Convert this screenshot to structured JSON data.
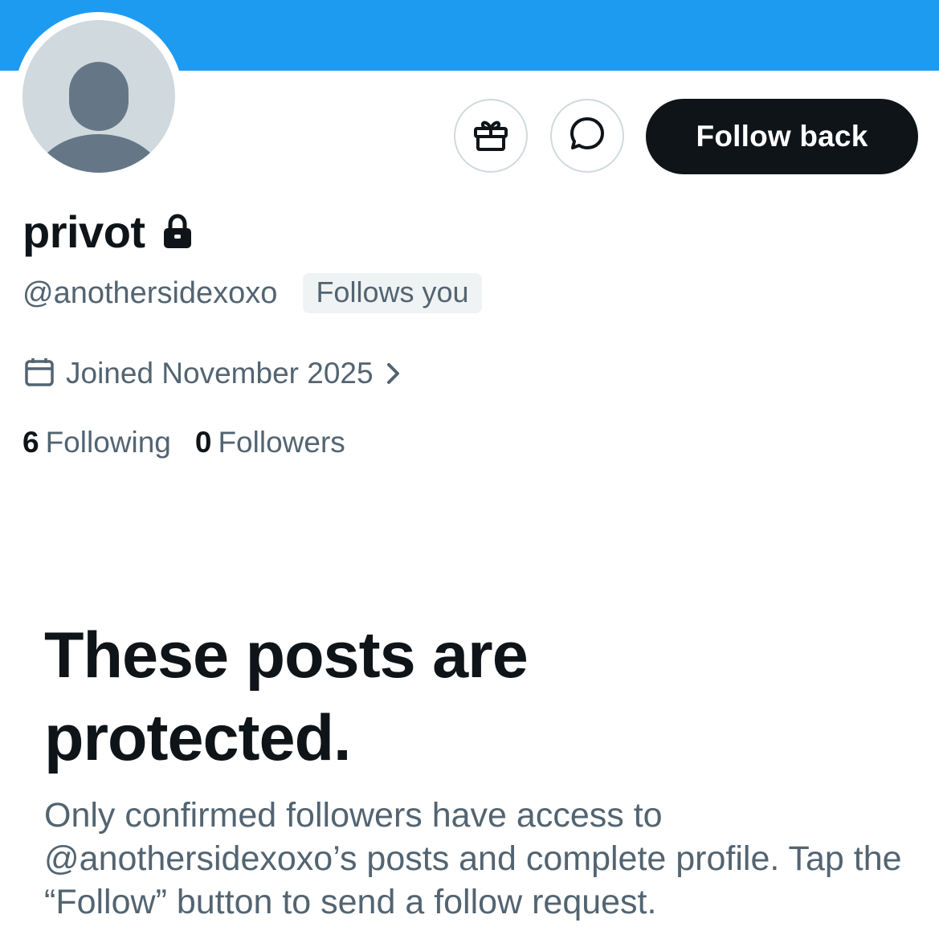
{
  "colors": {
    "banner": "#1d9bf0",
    "text_primary": "#0f1419",
    "text_secondary": "#536471",
    "button_dark": "#0f1419",
    "border": "#cfd9de",
    "badge_bg": "#eff3f4",
    "avatar_bg": "#cfd9de",
    "avatar_figure": "#657786"
  },
  "header": {
    "icons": {
      "gift": "gift-icon",
      "message": "message-icon"
    },
    "follow_back_label": "Follow back"
  },
  "profile": {
    "display_name": "privot",
    "lock_icon": "lock-icon",
    "handle": "@anothersidexoxo",
    "follows_you_badge": "Follows you",
    "joined": "Joined November 2025",
    "calendar_icon": "calendar-icon",
    "chevron_icon": "chevron-right-icon",
    "following_count": "6",
    "following_label": "Following",
    "followers_count": "0",
    "followers_label": "Followers"
  },
  "protected": {
    "title": "These posts are protected.",
    "description": "Only confirmed followers have access to @anothersidexoxo’s posts and complete profile. Tap the “Follow” button to send a follow request."
  }
}
